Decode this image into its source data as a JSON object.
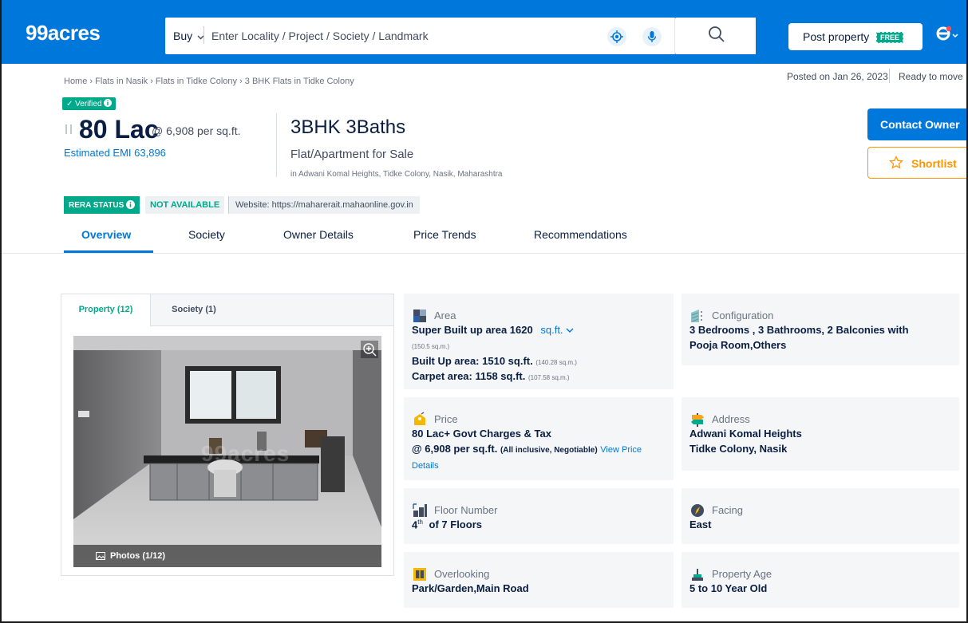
{
  "header": {
    "logo": "99acres",
    "buy_label": "Buy",
    "search_placeholder": "Enter Locality / Project / Society / Landmark",
    "post_label": "Post property",
    "free_badge": "FREE",
    "brand_color": "#0078db"
  },
  "title_area": {
    "breadcrumb": "Home › Flats in Nasik › Flats in Tidke Colony › 3 BHK Flats in Tidke Colony",
    "posted": "Posted on Jan 26, 2023",
    "status": "Ready to move",
    "verified": "✓ Verified",
    "price": "80 Lac",
    "per_sqft": "@ 6,908 per sq.ft.",
    "emi": "Estimated EMI  63,896",
    "bhk": "3BHK 3Baths",
    "property_type": "Flat/Apartment for Sale",
    "location": "in Adwani Komal Heights, Tidke Colony, Nasik, Maharashtra",
    "contact_label": "Contact Owner",
    "shortlist_label": "Shortlist"
  },
  "rera": {
    "label": "RERA STATUS",
    "value": "NOT AVAILABLE",
    "website": "Website: https://maharerait.mahaonline.gov.in"
  },
  "tabs": [
    {
      "label": "Overview",
      "active": true
    },
    {
      "label": "Society"
    },
    {
      "label": "Owner Details"
    },
    {
      "label": "Price Trends"
    },
    {
      "label": "Recommendations"
    }
  ],
  "photos": {
    "tab_property": "Property (12)",
    "tab_society": "Society (1)",
    "photos_label": "Photos (1/12)",
    "watermark": "99acres"
  },
  "details": {
    "area": {
      "label": "Area",
      "super_built": "Super Built up area 1620",
      "unit": "sq.ft.",
      "super_sqm": "(150.5 sq.m.)",
      "built_up": "Built Up area: 1510 sq.ft.",
      "built_up_sqm": "(140.28 sq.m.)",
      "carpet": "Carpet area: 1158 sq.ft.",
      "carpet_sqm": "(107.58 sq.m.)"
    },
    "configuration": {
      "label": "Configuration",
      "line1": "3 Bedrooms , 3 Bathrooms, 2 Balconies with",
      "line2": "Pooja Room,Others"
    },
    "price": {
      "label": "Price",
      "line1": " 80 Lac+ Govt Charges & Tax",
      "line2": "@ 6,908 per sq.ft.",
      "inclusive": "(All inclusive, Negotiable)",
      "view": "View Price",
      "details": "Details"
    },
    "address": {
      "label": "Address",
      "line1": "Adwani Komal Heights",
      "line2": "Tidke Colony, Nasik"
    },
    "floor": {
      "label": "Floor Number",
      "floor": "4",
      "suffix": "th",
      "rest": "of 7 Floors"
    },
    "facing": {
      "label": "Facing",
      "value": "East"
    },
    "overlooking": {
      "label": "Overlooking",
      "value": "Park/Garden,Main Road"
    },
    "age": {
      "label": "Property Age",
      "value": "5 to 10 Year Old"
    }
  }
}
